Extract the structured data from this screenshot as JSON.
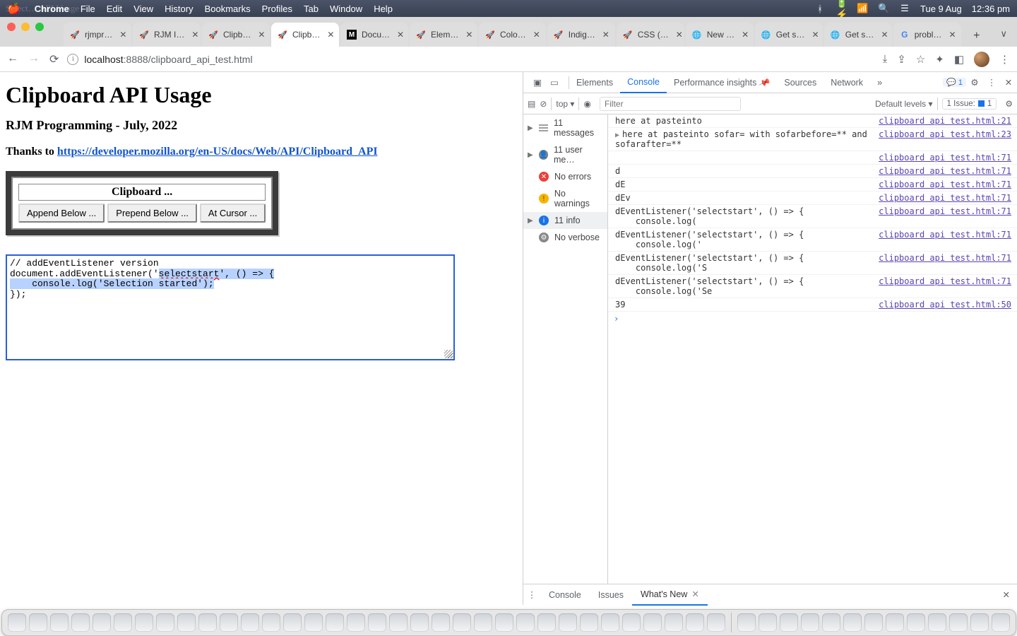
{
  "menubar": {
    "app": "Chrome",
    "items": [
      "File",
      "Edit",
      "View",
      "History",
      "Bookmarks",
      "Profiles",
      "Tab",
      "Window",
      "Help"
    ],
    "ghost_text": "Select… API Usage",
    "status": {
      "date": "Tue 9 Aug",
      "time": "12:36 pm"
    }
  },
  "browser": {
    "tabs": [
      {
        "label": "rjmpr…",
        "icon": "rocket",
        "active": false
      },
      {
        "label": "RJM I…",
        "icon": "rocket",
        "active": false
      },
      {
        "label": "Clipb…",
        "icon": "rocket",
        "active": false
      },
      {
        "label": "Clipb…",
        "icon": "rocket",
        "active": true
      },
      {
        "label": "Docu…",
        "icon": "m",
        "active": false
      },
      {
        "label": "Elem…",
        "icon": "rocket",
        "active": false
      },
      {
        "label": "Colo…",
        "icon": "rocket",
        "active": false
      },
      {
        "label": "Indig…",
        "icon": "rocket",
        "active": false
      },
      {
        "label": "CSS (…",
        "icon": "rocket",
        "active": false
      },
      {
        "label": "New …",
        "icon": "world",
        "active": false
      },
      {
        "label": "Get s…",
        "icon": "world",
        "active": false
      },
      {
        "label": "Get s…",
        "icon": "world",
        "active": false
      },
      {
        "label": "probl…",
        "icon": "g",
        "active": false
      }
    ],
    "url_host": "localhost",
    "url_port": ":8888",
    "url_path": "/clipboard_api_test.html"
  },
  "page": {
    "h1": "Clipboard API Usage",
    "byline": "RJM Programming - July, 2022",
    "thanks_prefix": "Thanks to ",
    "thanks_link_text": "https://developer.mozilla.org/en-US/docs/Web/API/Clipboard_API",
    "panel_title": "Clipboard ...",
    "buttons": {
      "append": "Append Below ...",
      "prepend": "Prepend Below ...",
      "cursor": "At Cursor ..."
    },
    "code": {
      "l1": "// addEventListener version",
      "l2a": "document.addEventListener('",
      "l2b": "selectstart",
      "l2c": "', () => {",
      "l3": "    console.log('Selection started');",
      "l4": "});"
    }
  },
  "devtools": {
    "tabs": {
      "elements": "Elements",
      "console": "Console",
      "perf": "Performance insights",
      "sources": "Sources",
      "network": "Network"
    },
    "more": "»",
    "msgbadge": "1",
    "filterbar": {
      "context": "top ▾",
      "filter_placeholder": "Filter",
      "levels": "Default levels ▾",
      "issue_label": "1 Issue:",
      "issue_count": "1"
    },
    "sidebar": {
      "messages": "11 messages",
      "userm": "11 user me…",
      "noerrors": "No errors",
      "nowarn": "No warnings",
      "info": "11 info",
      "noverbose": "No verbose"
    },
    "entries": [
      {
        "msg": "here at pasteinto",
        "link": "clipboard api test.html:21",
        "group": false
      },
      {
        "msg": "here at pasteinto sofar= with sofarbefore=** and\nsofarafter=**",
        "link": "clipboard api test.html:23",
        "group": true
      },
      {
        "msg": "",
        "link": "clipboard api test.html:71",
        "group": false
      },
      {
        "msg": "d",
        "link": "clipboard api test.html:71",
        "group": false
      },
      {
        "msg": "dE",
        "link": "clipboard api test.html:71",
        "group": false
      },
      {
        "msg": "dEv",
        "link": "clipboard api test.html:71",
        "group": false
      },
      {
        "msg": "dEventListener('selectstart', () => {\n    console.log(",
        "link": "clipboard api test.html:71",
        "group": false
      },
      {
        "msg": "dEventListener('selectstart', () => {\n    console.log('",
        "link": "clipboard api test.html:71",
        "group": false
      },
      {
        "msg": "dEventListener('selectstart', () => {\n    console.log('S",
        "link": "clipboard api test.html:71",
        "group": false
      },
      {
        "msg": "dEventListener('selectstart', () => {\n    console.log('Se",
        "link": "clipboard api test.html:71",
        "group": false
      },
      {
        "msg": "39",
        "link": "clipboard api test.html:50",
        "group": false
      }
    ],
    "drawer": {
      "console": "Console",
      "issues": "Issues",
      "whatsnew": "What's New"
    }
  },
  "icons": {
    "bluetooth": "⌁",
    "wifi": "⌃",
    "search": "🔍",
    "control": "▦",
    "back": "←",
    "forward": "→",
    "reload": "⟳",
    "share": "⇪",
    "star": "☆",
    "ext": "✦",
    "panel": "◧",
    "kebab": "⋮",
    "install": "⤓",
    "inspect": "▣",
    "device": "▭",
    "clear": "⊘",
    "eye": "◉",
    "settings": "⚙",
    "plus": "+",
    "chev": "∨",
    "closex": "✕",
    "expand": "»"
  }
}
